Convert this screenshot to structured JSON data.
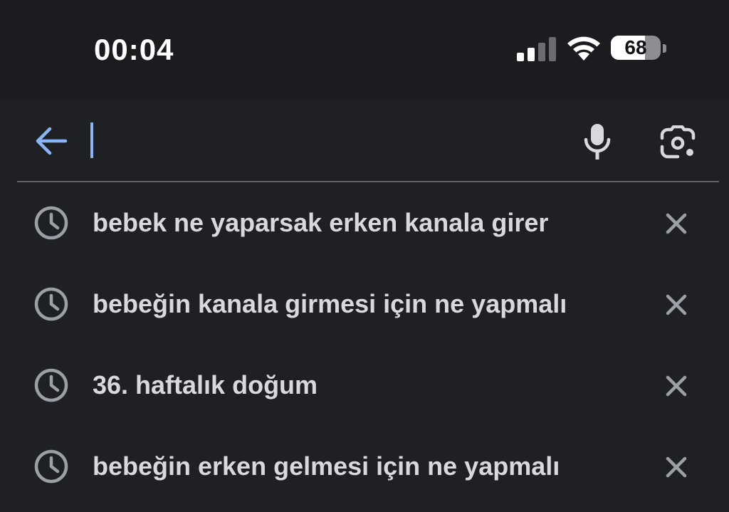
{
  "status_bar": {
    "time": "00:04",
    "battery_level": "68",
    "battery_fraction": 0.68,
    "signal_bars_active": 2,
    "signal_bars_total": 4
  },
  "search": {
    "query": "",
    "back_icon": "arrow-left-icon",
    "voice_icon": "microphone-icon",
    "lens_icon": "camera-lens-icon"
  },
  "suggestions": [
    {
      "text": "bebek ne yaparsak erken kanala girer",
      "icon": "history-icon",
      "action_icon": "close-icon"
    },
    {
      "text": "bebeğin kanala girmesi için ne yapmalı",
      "icon": "history-icon",
      "action_icon": "close-icon"
    },
    {
      "text": "36. haftalık doğum",
      "icon": "history-icon",
      "action_icon": "close-icon"
    },
    {
      "text": "bebeğin erken gelmesi için ne yapmalı",
      "icon": "history-icon",
      "action_icon": "close-icon"
    }
  ],
  "colors": {
    "background": "#1f2023",
    "accent": "#8ab4f8",
    "text": "#d7d9dc",
    "icon": "#9aa0a6"
  }
}
